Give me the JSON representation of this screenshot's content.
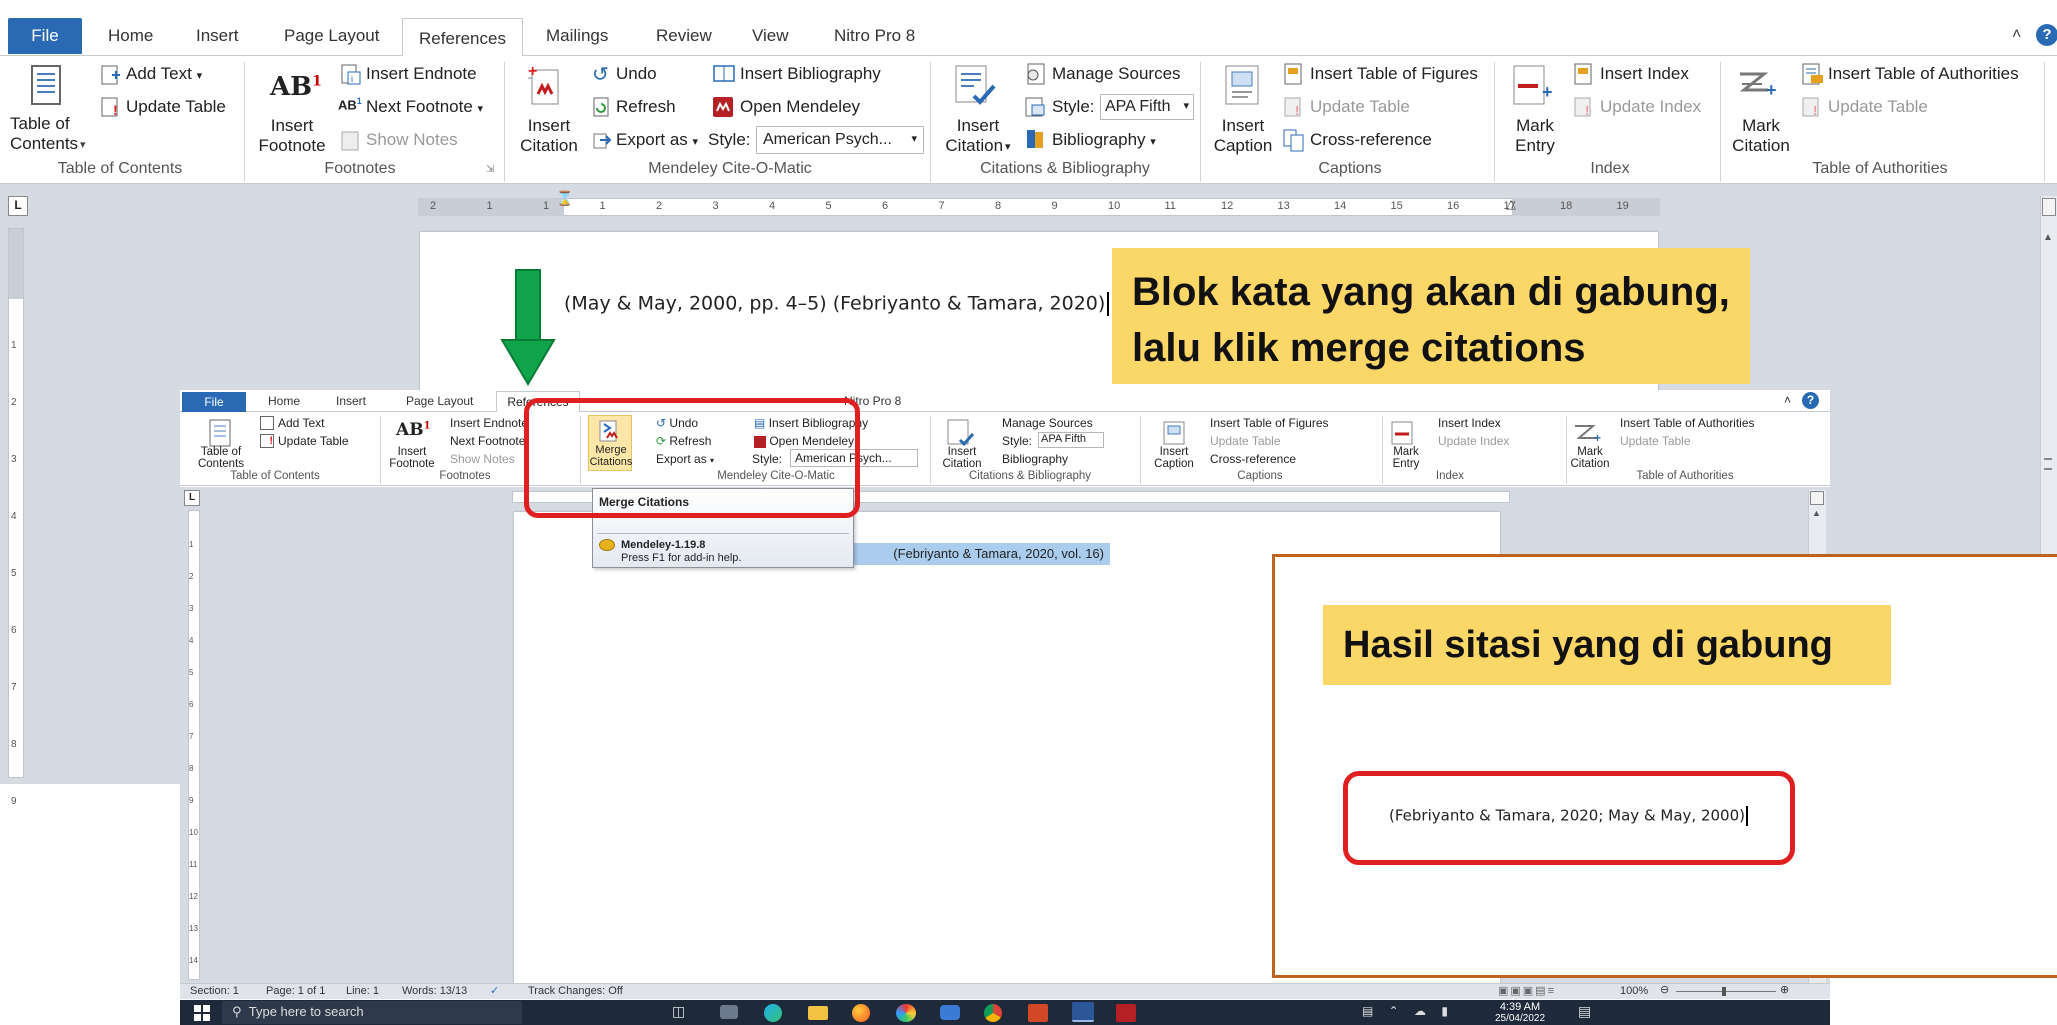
{
  "ribbon": {
    "tabs": [
      "File",
      "Home",
      "Insert",
      "Page Layout",
      "References",
      "Mailings",
      "Review",
      "View",
      "Nitro Pro 8"
    ],
    "toc": {
      "button_line1": "Table of",
      "button_line2": "Contents",
      "add_text": "Add Text",
      "update_table": "Update Table",
      "group": "Table of Contents"
    },
    "footnotes": {
      "insert_line1": "Insert",
      "insert_line2": "Footnote",
      "insert_endnote": "Insert Endnote",
      "next_footnote": "Next Footnote",
      "show_notes": "Show Notes",
      "group": "Footnotes"
    },
    "mendeley": {
      "insert_line1": "Insert",
      "insert_line2": "Citation",
      "undo": "Undo",
      "refresh": "Refresh",
      "export_as": "Export as",
      "style_label": "Style:",
      "style_value": "American Psych...",
      "insert_bibliography": "Insert Bibliography",
      "open_mendeley": "Open Mendeley",
      "group": "Mendeley Cite-O-Matic"
    },
    "citations": {
      "insert_line1": "Insert",
      "insert_line2": "Citation",
      "manage_sources": "Manage Sources",
      "style_label": "Style:",
      "style_value": "APA Fifth",
      "bibliography": "Bibliography",
      "group": "Citations & Bibliography"
    },
    "captions": {
      "insert_line1": "Insert",
      "insert_line2": "Caption",
      "insert_tof": "Insert Table of Figures",
      "update_table": "Update Table",
      "cross_reference": "Cross-reference",
      "group": "Captions"
    },
    "index": {
      "mark_line1": "Mark",
      "mark_line2": "Entry",
      "insert_index": "Insert Index",
      "update_index": "Update Index",
      "group": "Index"
    },
    "toa": {
      "mark_line1": "Mark",
      "mark_line2": "Citation",
      "insert_toa": "Insert Table of Authorities",
      "update_table": "Update Table",
      "group": "Table of Authorities"
    }
  },
  "overlay": {
    "merge_line1": "Merge",
    "merge_line2": "Citations",
    "style_value": "American Psych...",
    "style_value_citations": "APA Fifth",
    "tooltip_title": "Merge Citations",
    "tooltip_addin": "Mendeley-1.19.8",
    "tooltip_help": "Press F1 for add-in help.",
    "selected_text": "(Febriyanto & Tamara, 2020, vol. 16)"
  },
  "document": {
    "citation_text": "(May & May, 2000, pp. 4–5) (Febriyanto & Tamara, 2020)"
  },
  "callouts": {
    "instruction_line1": "Blok kata yang akan di gabung,",
    "instruction_line2": "lalu klik merge citations",
    "result_title": "Hasil sitasi yang di gabung",
    "result_text": "(Febriyanto & Tamara, 2020; May & May, 2000)"
  },
  "statusbar": {
    "section": "Section: 1",
    "page": "Page: 1 of 1",
    "line": "Line: 1",
    "words": "Words: 13/13",
    "track": "Track Changes: Off",
    "zoom": "100%"
  },
  "taskbar": {
    "search_placeholder": "Type here to search",
    "time": "4:39 AM",
    "date": "25/04/2022"
  },
  "ruler_top": [
    "2",
    "1",
    "1",
    "1",
    "2",
    "3",
    "4",
    "5",
    "6",
    "7",
    "8",
    "9",
    "10",
    "11",
    "12",
    "13",
    "14",
    "15",
    "16",
    "17",
    "18",
    "19"
  ],
  "ruler_left": [
    "1",
    "2",
    "3",
    "4",
    "5",
    "6",
    "7",
    "8",
    "9"
  ],
  "ruler_overlay_left": [
    "1",
    "2",
    "3",
    "4",
    "5",
    "6",
    "7",
    "8",
    "9",
    "10",
    "11",
    "12",
    "13",
    "14"
  ],
  "colors": {
    "file_tab": "#2a6ab5",
    "callout": "#fbd768",
    "red_highlight": "#e02020",
    "arrow": "#10a54a",
    "result_border": "#c0621f",
    "selection": "#aacdee"
  }
}
